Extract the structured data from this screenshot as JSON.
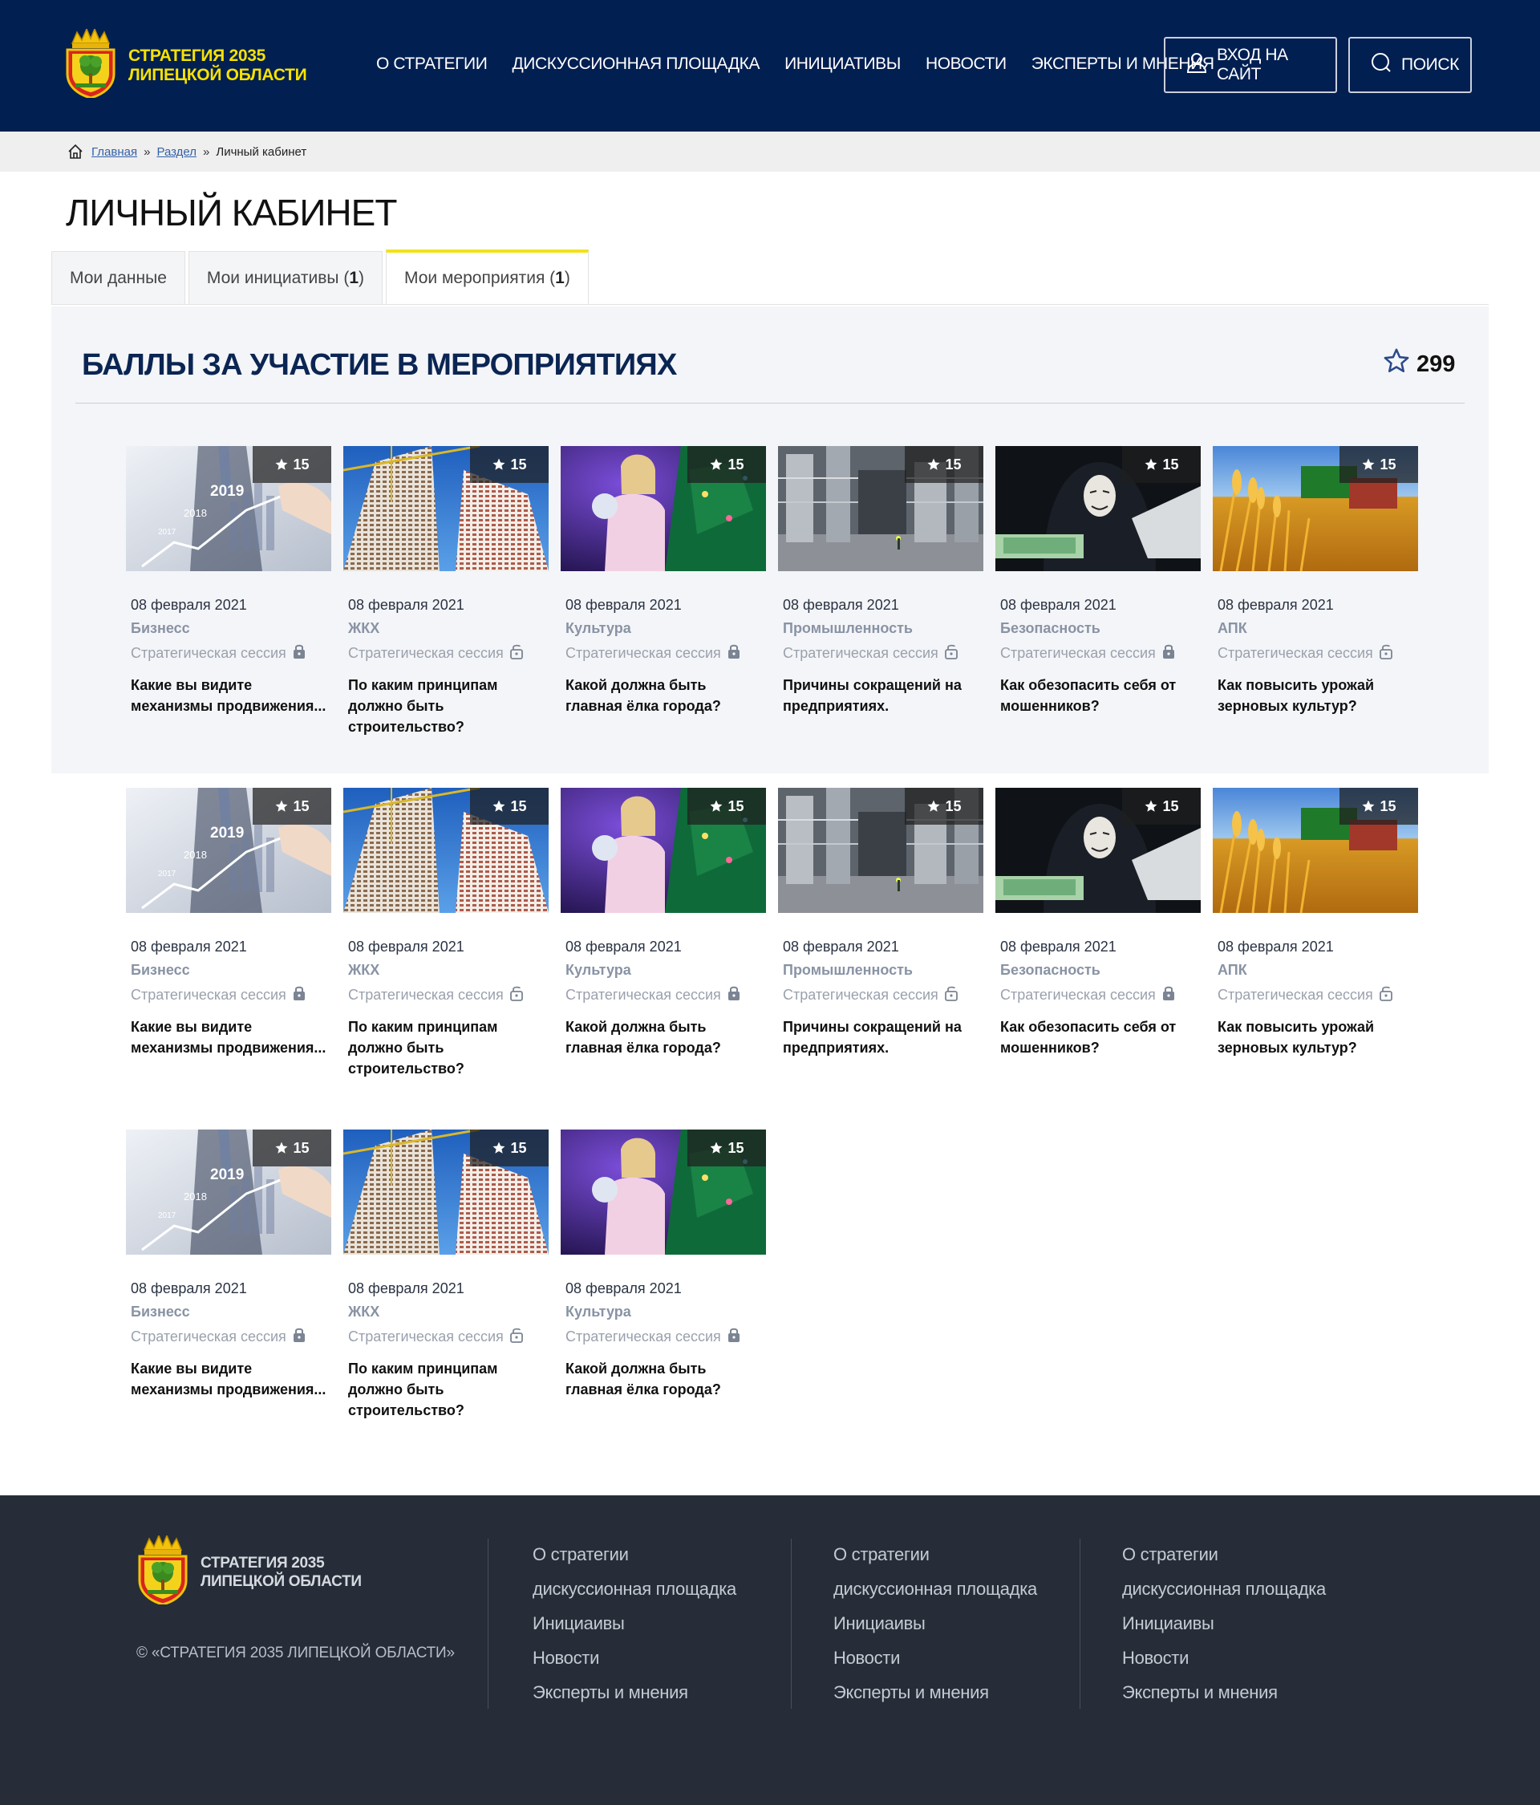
{
  "header": {
    "logo_line1": "СТРАТЕГИЯ 2035",
    "logo_line2": "ЛИПЕЦКОЙ ОБЛАСТИ",
    "nav": [
      "О СТРАТЕГИИ",
      "ДИСКУССИОННАЯ ПЛОЩАДКА",
      "ИНИЦИАТИВЫ",
      "НОВОСТИ",
      "ЭКСПЕРТЫ И МНЕНИЯ"
    ],
    "login_label": "ВХОД НА САЙТ",
    "search_label": "ПОИСК"
  },
  "breadcrumb": {
    "home": "Главная",
    "section": "Раздел",
    "sep": "»",
    "current": "Личный кабинет"
  },
  "page_title": "ЛИЧНЫЙ КАБИНЕТ",
  "tabs": [
    {
      "label": "Мои данные",
      "count": ""
    },
    {
      "label": "Мои инициативы",
      "count": "1"
    },
    {
      "label": "Мои мероприятия",
      "count": "1"
    }
  ],
  "section": {
    "title": "БАЛЛЫ ЗА УЧАСТИЕ В МЕРОПРИЯТИЯХ",
    "score": "299"
  },
  "cards": [
    {
      "points": "15",
      "date": "08 февраля 2021",
      "category": "Бизнесс",
      "type": "Стратегическая сессия",
      "title": "Какие вы видите механизмы продвижения...",
      "image": "business",
      "locked": true
    },
    {
      "points": "15",
      "date": "08 февраля 2021",
      "category": "ЖКХ",
      "type": "Стратегическая сессия",
      "title": "По каким принципам должно быть строительство?",
      "image": "building",
      "locked": false
    },
    {
      "points": "15",
      "date": "08 февраля 2021",
      "category": "Культура",
      "type": "Стратегическая сессия",
      "title": "Какой должна быть главная ёлка города?",
      "image": "tree",
      "locked": true
    },
    {
      "points": "15",
      "date": "08 февраля 2021",
      "category": "Промышленность",
      "type": "Стратегическая сессия",
      "title": "Причины сокращений на предприятиях.",
      "image": "factory",
      "locked": false
    },
    {
      "points": "15",
      "date": "08 февраля 2021",
      "category": "Безопасность",
      "type": "Стратегическая сессия",
      "title": "Как обезопасить себя от мошенников?",
      "image": "hacker",
      "locked": true
    },
    {
      "points": "15",
      "date": "08 февраля 2021",
      "category": "АПК",
      "type": "Стратегическая сессия",
      "title": "Как повысить урожай зерновых культур?",
      "image": "wheat",
      "locked": false
    },
    {
      "points": "15",
      "date": "08 февраля 2021",
      "category": "Бизнесс",
      "type": "Стратегическая сессия",
      "title": "Какие вы видите механизмы продвижения...",
      "image": "business",
      "locked": true
    },
    {
      "points": "15",
      "date": "08 февраля 2021",
      "category": "ЖКХ",
      "type": "Стратегическая сессия",
      "title": "По каким принципам должно быть строительство?",
      "image": "building",
      "locked": false
    },
    {
      "points": "15",
      "date": "08 февраля 2021",
      "category": "Культура",
      "type": "Стратегическая сессия",
      "title": "Какой должна быть главная ёлка города?",
      "image": "tree",
      "locked": true
    },
    {
      "points": "15",
      "date": "08 февраля 2021",
      "category": "Промышленность",
      "type": "Стратегическая сессия",
      "title": "Причины сокращений на предприятиях.",
      "image": "factory",
      "locked": false
    },
    {
      "points": "15",
      "date": "08 февраля 2021",
      "category": "Безопасность",
      "type": "Стратегическая сессия",
      "title": "Как обезопасить себя от мошенников?",
      "image": "hacker",
      "locked": true
    },
    {
      "points": "15",
      "date": "08 февраля 2021",
      "category": "АПК",
      "type": "Стратегическая сессия",
      "title": "Как повысить урожай зерновых культур?",
      "image": "wheat",
      "locked": false
    },
    {
      "points": "15",
      "date": "08 февраля 2021",
      "category": "Бизнесс",
      "type": "Стратегическая сессия",
      "title": "Какие вы видите механизмы продвижения...",
      "image": "business",
      "locked": true
    },
    {
      "points": "15",
      "date": "08 февраля 2021",
      "category": "ЖКХ",
      "type": "Стратегическая сессия",
      "title": "По каким принципам должно быть строительство?",
      "image": "building",
      "locked": false
    },
    {
      "points": "15",
      "date": "08 февраля 2021",
      "category": "Культура",
      "type": "Стратегическая сессия",
      "title": "Какой должна быть главная ёлка города?",
      "image": "tree",
      "locked": true
    }
  ],
  "chart_years": [
    "2017",
    "2018",
    "2019"
  ],
  "footer": {
    "logo_line1": "СТРАТЕГИЯ 2035",
    "logo_line2": "ЛИПЕЦКОЙ ОБЛАСТИ",
    "copyright": "© «СТРАТЕГИЯ 2035 ЛИПЕЦКОЙ ОБЛАСТИ»",
    "columns": [
      [
        "О стратегии",
        "дискуссионная площадка",
        "Инициаивы",
        "Новости",
        "Эксперты и мнения"
      ],
      [
        "О стратегии",
        "дискуссионная площадка",
        "Инициаивы",
        "Новости",
        "Эксперты и мнения"
      ],
      [
        "О стратегии",
        "дискуссионная площадка",
        "Инициаивы",
        "Новости",
        "Эксперты и мнения"
      ]
    ]
  },
  "colors": {
    "header_bg": "#021f52",
    "logo_yellow": "#f7e200",
    "active_tab_accent": "#f2e21d",
    "section_title": "#0b2553",
    "footer_bg": "#262d38"
  },
  "icons": {
    "user": "user-icon",
    "search": "search-icon",
    "home": "home-icon",
    "star": "star-icon",
    "lock": "lock-icon",
    "emblem": "coat-of-arms-icon"
  }
}
